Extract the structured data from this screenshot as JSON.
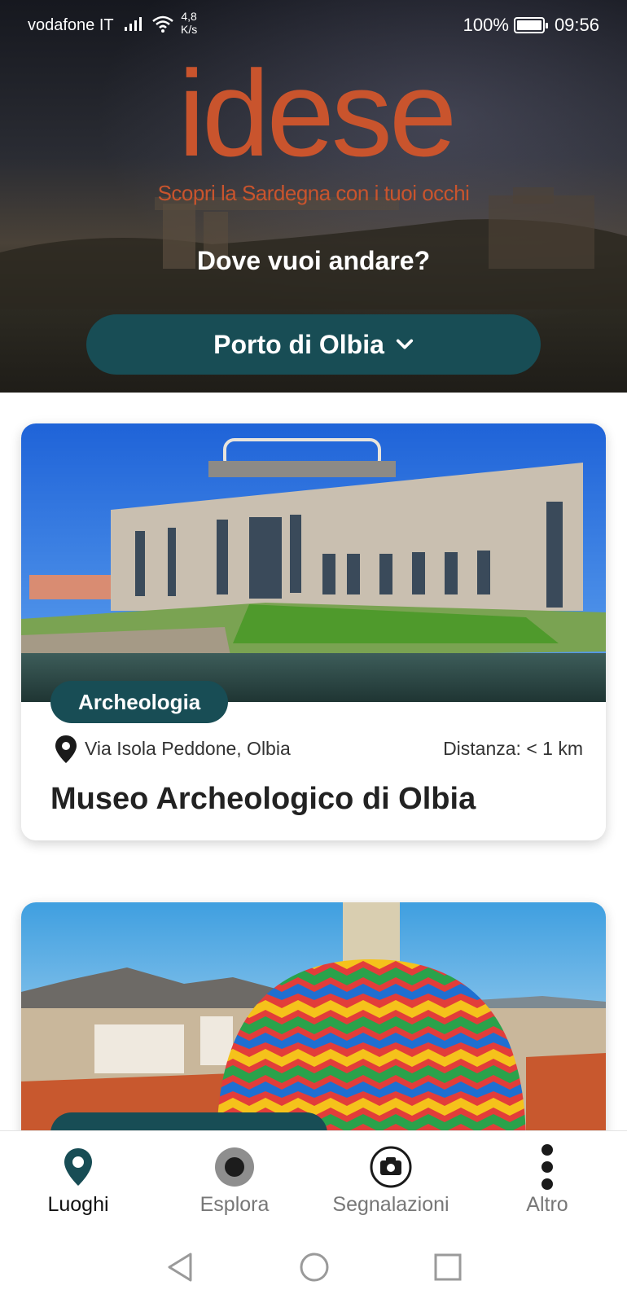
{
  "status_bar": {
    "carrier": "vodafone IT",
    "speed_value": "4,8",
    "speed_unit": "K/s",
    "battery": "100%",
    "time": "09:56"
  },
  "hero": {
    "logo_text": "idese",
    "tagline": "Scopri la Sardegna con i tuoi occhi",
    "question": "Dove vuoi andare?",
    "selected_location": "Porto di Olbia"
  },
  "cards": [
    {
      "category": "Archeologia",
      "address": "Via Isola Peddone, Olbia",
      "distance": "Distanza: < 1 km",
      "title": "Museo Archeologico di Olbia"
    }
  ],
  "bottom_nav": {
    "items": [
      {
        "label": "Luoghi",
        "icon": "map-pin-icon",
        "active": true
      },
      {
        "label": "Esplora",
        "icon": "record-icon",
        "active": false
      },
      {
        "label": "Segnalazioni",
        "icon": "camera-icon",
        "active": false
      },
      {
        "label": "Altro",
        "icon": "more-vertical-icon",
        "active": false
      }
    ]
  },
  "colors": {
    "primary": "#184d55",
    "logo": "#c9542d"
  }
}
